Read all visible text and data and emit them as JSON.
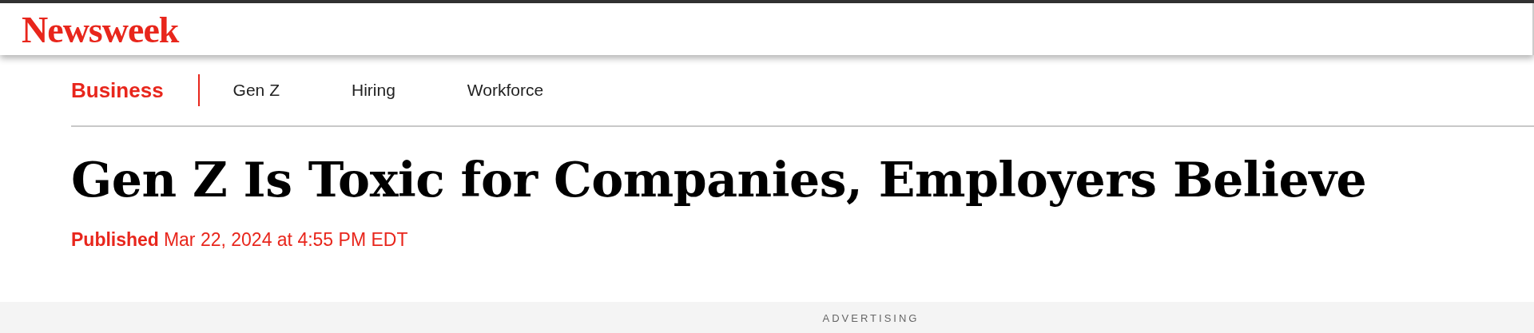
{
  "logo": "Newsweek",
  "nav": [
    {
      "label": "Business",
      "selected": true
    },
    {
      "label": "Gen Z",
      "selected": false
    },
    {
      "label": "Hiring",
      "selected": false
    },
    {
      "label": "Workforce",
      "selected": false
    }
  ],
  "headline": "Gen Z Is Toxic for Companies, Employers Believe",
  "published": {
    "label": "Published",
    "date": "Mar 22, 2024 at 4:55 PM EDT"
  },
  "ad_label": "ADVERTISING"
}
